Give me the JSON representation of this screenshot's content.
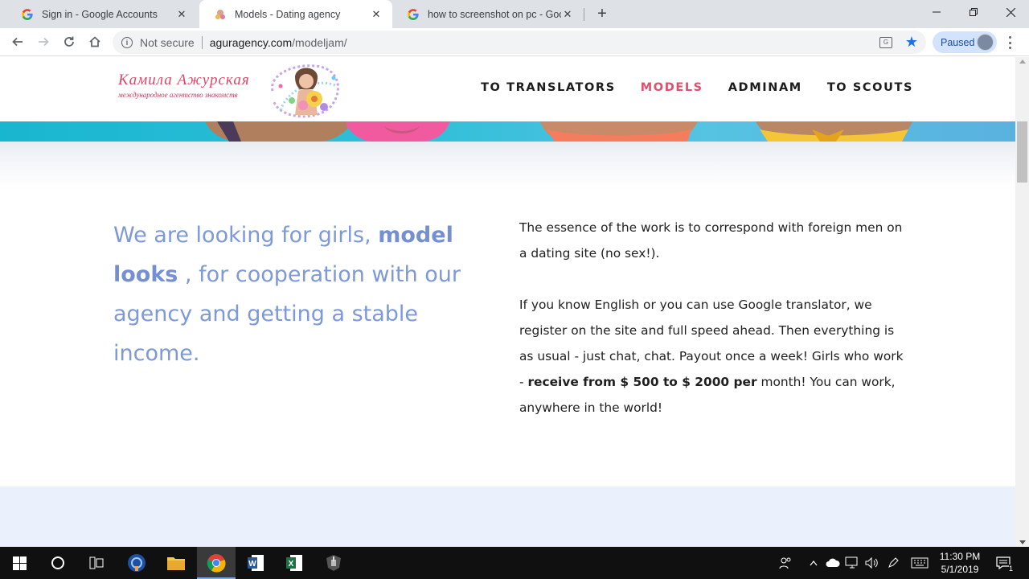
{
  "browser": {
    "tabs": [
      {
        "title": "Sign in - Google Accounts",
        "favicon": "google-g-icon",
        "active": false
      },
      {
        "title": "Models - Dating agency",
        "favicon": "site-icon",
        "active": true
      },
      {
        "title": "how to screenshot on pc - Googl",
        "favicon": "google-g-icon",
        "active": false
      }
    ],
    "address": {
      "security_label": "Not secure",
      "host": "aguragency.com",
      "path": "/modeljam/"
    },
    "profile_label": "Paused"
  },
  "site": {
    "logo": {
      "name": "Камила  Ажурская",
      "tagline": "международное агентство знакомств"
    },
    "nav": [
      {
        "label": "TO TRANSLATORS",
        "active": false
      },
      {
        "label": "MODELS",
        "active": true
      },
      {
        "label": "ADMINAM",
        "active": false
      },
      {
        "label": "TO SCOUTS",
        "active": false
      }
    ],
    "lead": {
      "part1": "We are looking for girls, ",
      "bold1": "model looks",
      "part2": " , for cooperation with our agency   and getting a stable income."
    },
    "desc": {
      "para1": "The essence of the work is to correspond with foreign men on a dating site (no sex!).",
      "para2_start": "If you know English or you can use Google translator, we register on the site and full speed ahead. Then everything is as usual - just   chat, chat. Payout once a week! Girls who work - ",
      "para2_bold": "receive from $ 500 to $ 2000 per",
      "para2_end": "  month! You can work, anywhere in the world!"
    }
  },
  "taskbar": {
    "apps": [
      "windows-start-icon",
      "cortana-circle-icon",
      "task-view-icon",
      "app-blue-icon",
      "file-explorer-icon",
      "chrome-icon",
      "word-icon",
      "excel-icon",
      "world-of-tanks-icon"
    ],
    "clock": {
      "time": "11:30 PM",
      "date": "5/1/2019"
    },
    "notification_count": "1"
  },
  "colors": {
    "nav_active": "#e0506e",
    "lead_text": "#7d99d8",
    "banner": "#2fbfd9",
    "bottom_band": "#eaf0fc"
  }
}
